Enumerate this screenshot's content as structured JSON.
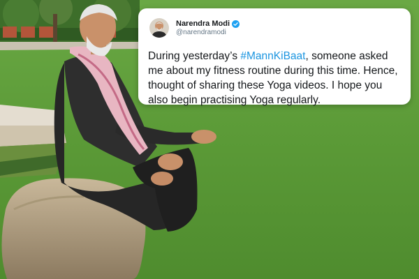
{
  "tweet": {
    "author_name": "Narendra Modi",
    "author_handle": "@narendramodi",
    "verified": true,
    "text_before": "During yesterday’s ",
    "hashtag": "#MannKiBaat",
    "text_after": ", someone asked me about my fitness routine during this time. Hence, thought of sharing these Yoga videos.  I hope you also begin practising Yoga regularly."
  },
  "colors": {
    "hashtag": "#1b95e0",
    "verified_badge": "#1da1f2",
    "lawn": "#5f9e3c"
  },
  "icons": {
    "verified": "verified-badge-icon",
    "avatar": "avatar"
  }
}
